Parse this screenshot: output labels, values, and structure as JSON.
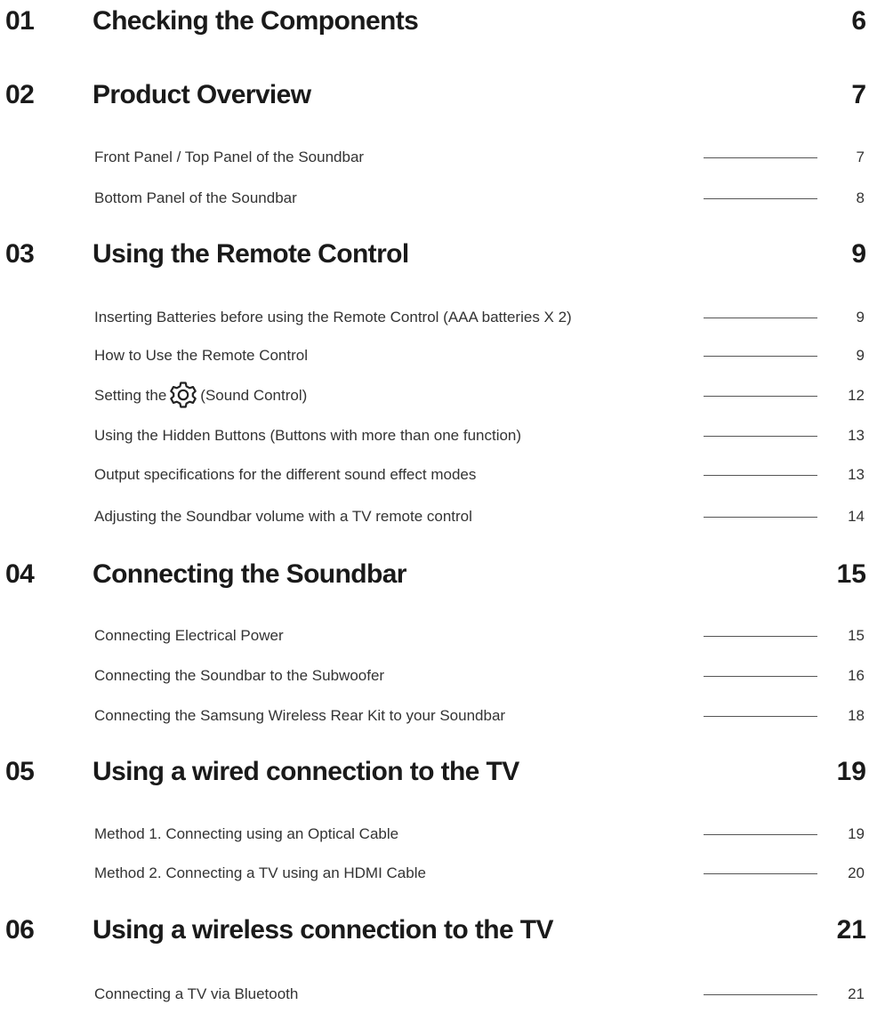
{
  "chapters": [
    {
      "num": "01",
      "title": "Checking the Components",
      "page": "6"
    },
    {
      "num": "02",
      "title": "Product Overview",
      "page": "7",
      "sections": [
        {
          "title": "Front Panel / Top Panel of the Soundbar",
          "page": "7"
        },
        {
          "title": "Bottom Panel of the Soundbar",
          "page": "8"
        }
      ]
    },
    {
      "num": "03",
      "title": "Using the Remote Control",
      "page": "9",
      "sections": [
        {
          "title": "Inserting Batteries before using the Remote Control (AAA batteries X 2)",
          "page": "9"
        },
        {
          "title": "How to Use the Remote Control",
          "page": "9"
        },
        {
          "title_before": "Setting the",
          "icon": "gear-icon",
          "title_after": "(Sound Control)",
          "page": "12"
        },
        {
          "title": "Using the Hidden Buttons (Buttons with more than one function)",
          "page": "13"
        },
        {
          "title": "Output specifications for the different sound effect modes",
          "page": "13"
        },
        {
          "title": "Adjusting the Soundbar volume with a TV remote control",
          "page": "14"
        }
      ]
    },
    {
      "num": "04",
      "title": "Connecting the Soundbar",
      "page": "15",
      "sections": [
        {
          "title": "Connecting Electrical Power",
          "page": "15"
        },
        {
          "title": "Connecting the Soundbar to the Subwoofer",
          "page": "16"
        },
        {
          "title": "Connecting the Samsung Wireless Rear Kit to your Soundbar",
          "page": "18"
        }
      ]
    },
    {
      "num": "05",
      "title": "Using a wired connection to the TV",
      "page": "19",
      "sections": [
        {
          "title": "Method 1. Connecting using an Optical Cable",
          "page": "19"
        },
        {
          "title": "Method 2. Connecting a TV using an HDMI Cable",
          "page": "20"
        }
      ]
    },
    {
      "num": "06",
      "title": "Using a wireless connection to the TV",
      "page": "21",
      "sections": [
        {
          "title": "Connecting a TV via Bluetooth",
          "page": "21"
        }
      ]
    }
  ]
}
